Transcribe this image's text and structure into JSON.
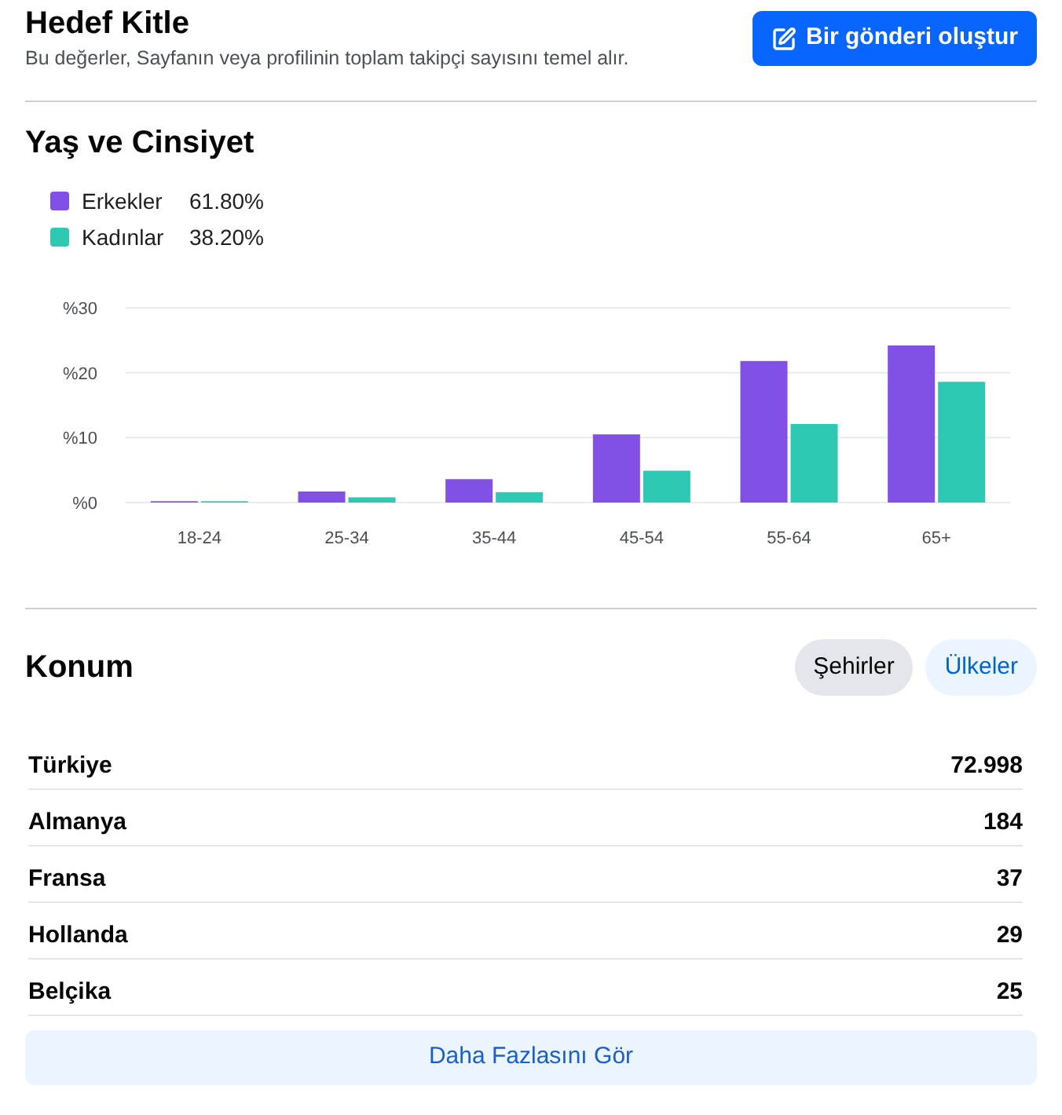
{
  "header": {
    "title": "Hedef Kitle",
    "subtitle": "Bu değerler, Sayfanın veya profilinin toplam takipçi sayısını temel alır.",
    "action_button": "Bir gönderi oluştur"
  },
  "age_gender": {
    "title": "Yaş ve Cinsiyet",
    "shares": [
      "61.80%",
      "38.20%"
    ],
    "chart_data": {
      "type": "bar",
      "categories": [
        "18-24",
        "25-34",
        "35-44",
        "45-54",
        "55-64",
        "65+"
      ],
      "series": [
        {
          "name": "Erkekler",
          "color": "#8250e5",
          "values": [
            0.2,
            1.7,
            3.6,
            10.5,
            21.8,
            24.2
          ]
        },
        {
          "name": "Kadınlar",
          "color": "#2ec8b3",
          "values": [
            0.2,
            0.8,
            1.6,
            4.9,
            12.1,
            18.6
          ]
        }
      ],
      "ylim": [
        0,
        30
      ],
      "yticks": [
        {
          "value": 0,
          "label": "%0"
        },
        {
          "value": 10,
          "label": "%10"
        },
        {
          "value": 20,
          "label": "%20"
        },
        {
          "value": 30,
          "label": "%30"
        }
      ]
    }
  },
  "location": {
    "title": "Konum",
    "filters": [
      {
        "label": "Şehirler",
        "selected": false
      },
      {
        "label": "Ülkeler",
        "selected": true
      }
    ],
    "rows": [
      {
        "name": "Türkiye",
        "count": "72.998"
      },
      {
        "name": "Almanya",
        "count": "184"
      },
      {
        "name": "Fransa",
        "count": "37"
      },
      {
        "name": "Hollanda",
        "count": "29"
      },
      {
        "name": "Belçika",
        "count": "25"
      }
    ],
    "more_button": "Daha Fazlasını Gör"
  }
}
